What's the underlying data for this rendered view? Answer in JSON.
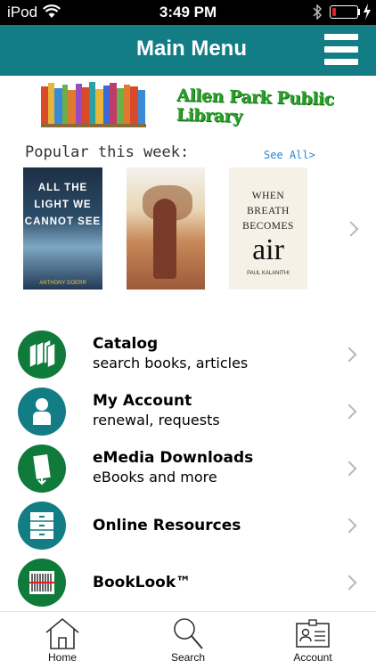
{
  "status_bar": {
    "carrier": "iPod",
    "time": "3:49 PM",
    "battery_percent": 15
  },
  "navbar": {
    "title": "Main Menu"
  },
  "banner": {
    "library_name": "Allen Park Public Library"
  },
  "popular": {
    "heading": "Popular this week:",
    "see_all": "See All>",
    "books": [
      {
        "title": "ALL THE LIGHT WE CANNOT SEE",
        "author": "ANTHONY DOERR"
      },
      {
        "title": ""
      },
      {
        "title_line1": "WHEN",
        "title_line2": "BREATH",
        "title_line3": "BECOMES",
        "title_line4": "air",
        "author": "PAUL KALANITHI"
      }
    ]
  },
  "menu": [
    {
      "label": "Catalog",
      "sub": "search books, articles",
      "icon": "books-icon"
    },
    {
      "label": "My Account",
      "sub": "renewal, requests",
      "icon": "person-icon"
    },
    {
      "label": "eMedia Downloads",
      "sub": "eBooks and more",
      "icon": "ebook-download-icon"
    },
    {
      "label": "Online Resources",
      "sub": "",
      "icon": "cabinet-icon"
    },
    {
      "label": "BookLook™",
      "sub": "",
      "icon": "barcode-icon"
    }
  ],
  "tabs": [
    {
      "label": "Home",
      "icon": "home-icon"
    },
    {
      "label": "Search",
      "icon": "search-icon"
    },
    {
      "label": "Account",
      "icon": "id-card-icon"
    }
  ],
  "colors": {
    "navbar": "#137d86",
    "green": "#0f7a3a",
    "link": "#2a86d6"
  }
}
